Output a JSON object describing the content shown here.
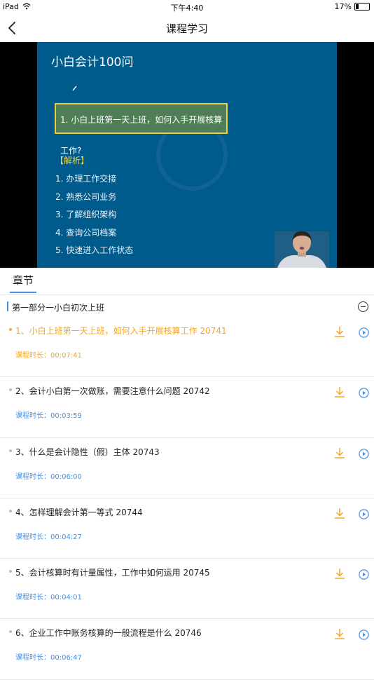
{
  "status_bar": {
    "device": "iPad",
    "time": "下午4:40",
    "battery": "17%"
  },
  "nav": {
    "title": "课程学习"
  },
  "slide": {
    "title": "小白会计100问",
    "question": "1. 小白上班第一天上班，如何入手开展核算工作?",
    "analysis": "【解析】",
    "points": [
      "1. 办理工作交接",
      "2. 熟悉公司业务",
      "3. 了解组织架构",
      "4. 查询公司档案",
      "5. 快速进入工作状态"
    ]
  },
  "tabs": {
    "chapter": "章节"
  },
  "section": {
    "title": "第一部分一小白初次上班"
  },
  "lessons": [
    {
      "title": "1、小白上班第一天上班，如何入手开展核算工作 20741",
      "duration": "课程时长：00:07:41"
    },
    {
      "title": "2、会计小白第一次做账，需要注意什么问题 20742",
      "duration": "课程时长：00:03:59"
    },
    {
      "title": "3、什么是会计隐性（假）主体 20743",
      "duration": "课程时长：00:06:00"
    },
    {
      "title": "4、怎样理解会计第一等式 20744",
      "duration": "课程时长：00:04:27"
    },
    {
      "title": "5、会计核算时有计量属性，工作中如何运用 20745",
      "duration": "课程时长：00:04:01"
    },
    {
      "title": "6、企业工作中账务核算的一般流程是什么 20746",
      "duration": "课程时长：00:06:47"
    }
  ],
  "colors": {
    "accent": "#f5a623",
    "link": "#4a90e2",
    "slide_bg": "#005b8d",
    "question_border": "#e6d24a"
  },
  "icons": {
    "back": "chevron-left-icon",
    "download": "download-icon",
    "play": "play-circle-icon",
    "collapse": "minus-circle-icon",
    "wifi": "wifi-icon",
    "battery": "battery-icon"
  }
}
